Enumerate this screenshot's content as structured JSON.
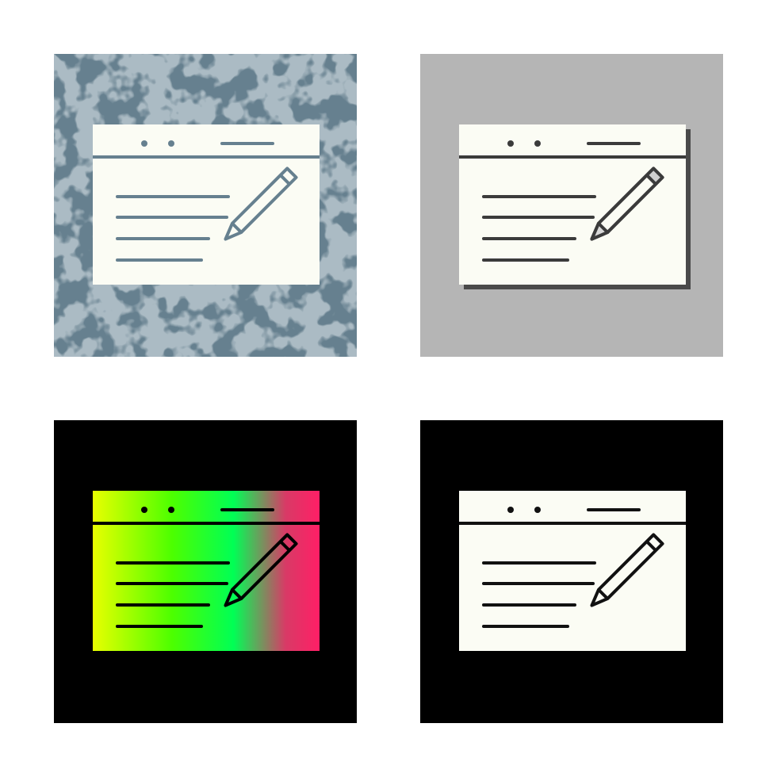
{
  "icon": "browser-window-edit-icon",
  "variants": [
    {
      "id": "tile-tl",
      "style": "glyph-textured",
      "background": "#66808f",
      "window": "#fbfcf4",
      "lines": "#66808f"
    },
    {
      "id": "tile-tr",
      "style": "flat-shadow",
      "background": "#b5b5b5",
      "window": "#fbfcf4",
      "lines": "#3b3b3b",
      "shadow": "#4a4a4a"
    },
    {
      "id": "tile-bl",
      "style": "gradient",
      "background": "#000000",
      "gradient": [
        "#e8ff00",
        "#4cff00",
        "#00ff55",
        "#ff1f66"
      ]
    },
    {
      "id": "tile-br",
      "style": "line-on-dark",
      "background": "#000000",
      "window": "#fbfcf4",
      "lines": "#111111"
    }
  ]
}
